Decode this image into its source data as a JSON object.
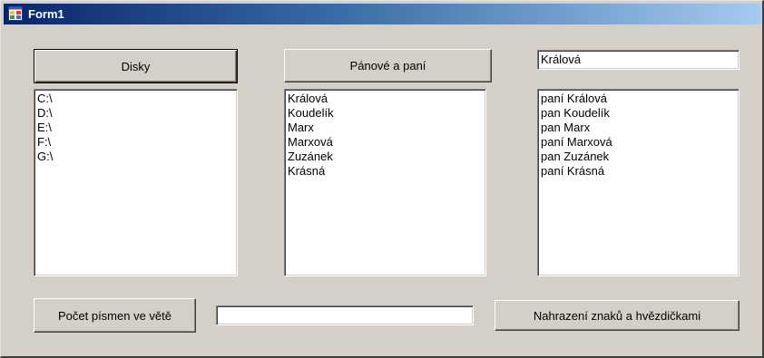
{
  "window": {
    "title": "Form1",
    "icon": "form-window-icon"
  },
  "buttons": {
    "disks": "Disky",
    "lords_ladies": "Pánové a paní",
    "letter_count": "Počet písmen ve větě",
    "replace_stars": "Nahrazení znaků a hvězdičkami"
  },
  "inputs": {
    "name_value": "Králová",
    "sentence_value": ""
  },
  "lists": {
    "drives": [
      "C:\\",
      "D:\\",
      "E:\\",
      "F:\\",
      "G:\\"
    ],
    "surnames": [
      "Králová",
      "Koudelík",
      "Marx",
      "Marxová",
      "Zuzánek",
      "Krásná"
    ],
    "titled_names": [
      "paní Králová",
      "pan Koudelík",
      "pan Marx",
      "paní Marxová",
      "pan Zuzánek",
      "paní Krásná"
    ]
  }
}
